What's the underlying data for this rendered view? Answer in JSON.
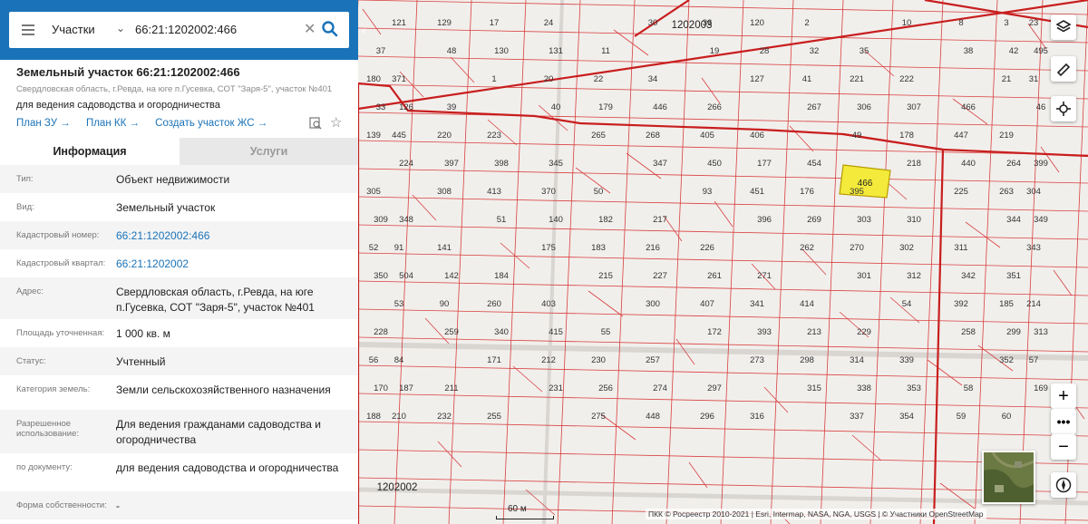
{
  "search": {
    "type_label": "Участки",
    "value": "66:21:1202002:466"
  },
  "parcel": {
    "title": "Земельный участок 66:21:1202002:466",
    "address_short": "Свердловская область, г.Ревда, на юге п.Гусевка, СОТ \"Заря-5\", участок №401",
    "purpose": "для ведения садоводства и огородничества",
    "links": [
      "План ЗУ →",
      "План КК →",
      "Создать участок ЖС →"
    ]
  },
  "tabs": [
    "Информация",
    "Услуги"
  ],
  "info_rows": [
    {
      "label": "Тип:",
      "value": "Объект недвижимости",
      "link": false
    },
    {
      "label": "Вид:",
      "value": "Земельный участок",
      "link": false
    },
    {
      "label": "Кадастровый номер:",
      "value": "66:21:1202002:466",
      "link": true
    },
    {
      "label": "Кадастровый квартал:",
      "value": "66:21:1202002",
      "link": true
    },
    {
      "label": "Адрес:",
      "value": "Свердловская область, г.Ревда, на юге п.Гусевка, СОТ \"Заря-5\", участок №401",
      "link": false
    },
    {
      "label": "Площадь уточненная:",
      "value": "1 000 кв. м",
      "link": false
    },
    {
      "label": "Статус:",
      "value": "Учтенный",
      "link": false
    },
    {
      "label": "Категория земель:",
      "value": "Земли сельскохозяйственного назначения",
      "link": false
    },
    {
      "label": "Разрешенное использование:",
      "value": "Для ведения гражданами садоводства и огородничества",
      "link": false
    },
    {
      "label": "по документу:",
      "value": "для ведения садоводства и огородничества",
      "link": false
    },
    {
      "label": "Форма собственности:",
      "value": "-",
      "link": false
    }
  ],
  "map": {
    "scale_label": "60 м",
    "attribution": "ПКК © Росреестр 2010-2021 | Esri, Intermap, NASA, NGA, USGS | © Участники OpenStreetMap",
    "quarter_labels": [
      "1202003",
      "1202002"
    ],
    "selected_parcel": "466",
    "parcels": [
      "121",
      "129",
      "17",
      "24",
      "30",
      "36",
      "120",
      "2",
      "10",
      "8",
      "3",
      "23",
      "37",
      "48",
      "130",
      "131",
      "11",
      "19",
      "28",
      "32",
      "35",
      "38",
      "42",
      "495",
      "180",
      "371",
      "1",
      "20",
      "22",
      "34",
      "127",
      "41",
      "221",
      "222",
      "21",
      "31",
      "33",
      "126",
      "39",
      "40",
      "179",
      "446",
      "266",
      "267",
      "306",
      "307",
      "466",
      "46",
      "139",
      "445",
      "220",
      "223",
      "265",
      "268",
      "405",
      "406",
      "49",
      "178",
      "447",
      "219",
      "224",
      "397",
      "398",
      "345",
      "347",
      "450",
      "177",
      "454",
      "218",
      "440",
      "264",
      "399",
      "305",
      "308",
      "413",
      "370",
      "50",
      "93",
      "451",
      "176",
      "395",
      "225",
      "263",
      "304",
      "309",
      "348",
      "51",
      "140",
      "182",
      "217",
      "396",
      "269",
      "303",
      "310",
      "344",
      "349",
      "52",
      "91",
      "141",
      "175",
      "183",
      "216",
      "226",
      "262",
      "270",
      "302",
      "311",
      "343",
      "350",
      "504",
      "142",
      "184",
      "215",
      "227",
      "261",
      "271",
      "301",
      "312",
      "342",
      "351",
      "53",
      "90",
      "260",
      "403",
      "300",
      "407",
      "341",
      "414",
      "54",
      "392",
      "185",
      "214",
      "228",
      "259",
      "340",
      "415",
      "55",
      "172",
      "393",
      "213",
      "229",
      "258",
      "299",
      "313",
      "56",
      "84",
      "171",
      "212",
      "230",
      "257",
      "273",
      "298",
      "314",
      "339",
      "352",
      "57",
      "170",
      "187",
      "211",
      "231",
      "256",
      "274",
      "297",
      "315",
      "338",
      "353",
      "58",
      "169",
      "188",
      "210",
      "232",
      "255",
      "275",
      "448",
      "296",
      "316",
      "337",
      "354",
      "59",
      "60"
    ]
  }
}
